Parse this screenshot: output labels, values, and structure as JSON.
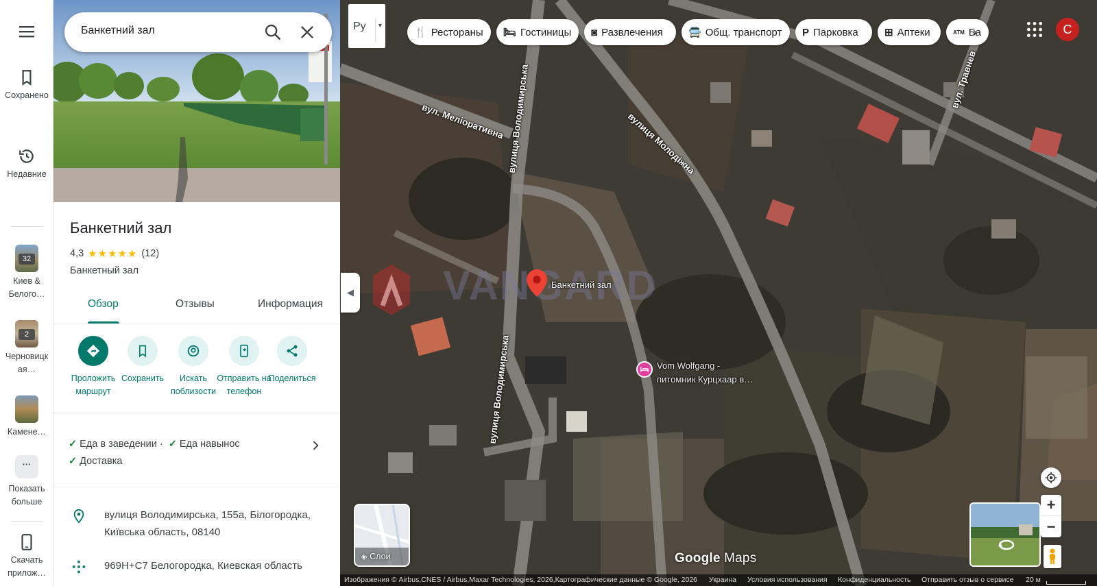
{
  "rail": {
    "menu_icon": "menu-icon",
    "items": [
      {
        "label": "Сохранено",
        "icon": "bookmark-icon"
      },
      {
        "label": "Недавние",
        "icon": "history-icon"
      },
      {
        "label": "Киев & Белого…",
        "badge": "32"
      },
      {
        "label": "Черновицкая…",
        "badge": "2"
      },
      {
        "label": "Камене…"
      },
      {
        "label": "Показать больше",
        "icon": "more-icon"
      },
      {
        "label": "Скачать прилож…",
        "icon": "phone-icon"
      }
    ]
  },
  "search": {
    "value": "Банкетний зал",
    "search_icon": "search-icon",
    "close_icon": "close-icon"
  },
  "place": {
    "title": "Банкетний зал",
    "rating": "4,3",
    "stars": "★★★★★",
    "reviews": "(12)",
    "category": "Банкетный зал"
  },
  "tabs": [
    "Обзор",
    "Отзывы",
    "Информация"
  ],
  "actions": [
    {
      "label": "Проложить маршрут",
      "icon": "directions-icon"
    },
    {
      "label": "Сохранить",
      "icon": "bookmark-icon"
    },
    {
      "label": "Искать поблизости",
      "icon": "nearby-icon"
    },
    {
      "label": "Отправить на телефон",
      "icon": "send-to-phone-icon"
    },
    {
      "label": "Поделиться",
      "icon": "share-icon"
    }
  ],
  "features": {
    "line1a": "Еда в заведении ·",
    "line1b": "Еда навынос",
    "line2": "Доставка"
  },
  "info": {
    "address": "вулиця Володимирська, 155а, Білогородка, Київська область, 08140",
    "plus_code": "969H+C7 Белогородка, Киевская область"
  },
  "map": {
    "lang_button": "Ру",
    "chips": [
      {
        "label": "Рестораны",
        "icon": "restaurant-icon"
      },
      {
        "label": "Гостиницы",
        "icon": "hotel-icon"
      },
      {
        "label": "Развлечения",
        "icon": "camera-icon"
      },
      {
        "label": "Общ. транспорт",
        "icon": "transit-icon"
      },
      {
        "label": "Парковка",
        "icon": "parking-icon"
      },
      {
        "label": "Аптеки",
        "icon": "pharmacy-icon"
      },
      {
        "label": "Ба",
        "icon": "atm-icon",
        "icon_text": "ATM"
      }
    ],
    "avatar_letter": "C",
    "pin_label": "Банкетний зал",
    "poi_label_1": "Vom Wolfgang -",
    "poi_label_2": "питомник Курцхаар в…",
    "roads": {
      "meliorativna": "вул. Меліоративна",
      "volodymyrska_top": "вулиця Володимирська",
      "volodymyrska_bottom": "вулиця Володимирська",
      "molodizhna": "вулиця Молодіжна",
      "travneva": "вул. Травнев"
    },
    "watermark": "VANGARD",
    "layers_label": "Слои",
    "google_logo": "Google",
    "google_logo_suffix": "Maps",
    "footer": {
      "imagery": "Изображения © Airbus,CNES / Airbus,Maxar Technologies, 2026,Картографические данные © Google, 2026",
      "country": "Украина",
      "terms": "Условия использования",
      "privacy": "Конфиденциальность",
      "feedback": "Отправить отзыв о сервисе",
      "scale": "20 м"
    }
  }
}
